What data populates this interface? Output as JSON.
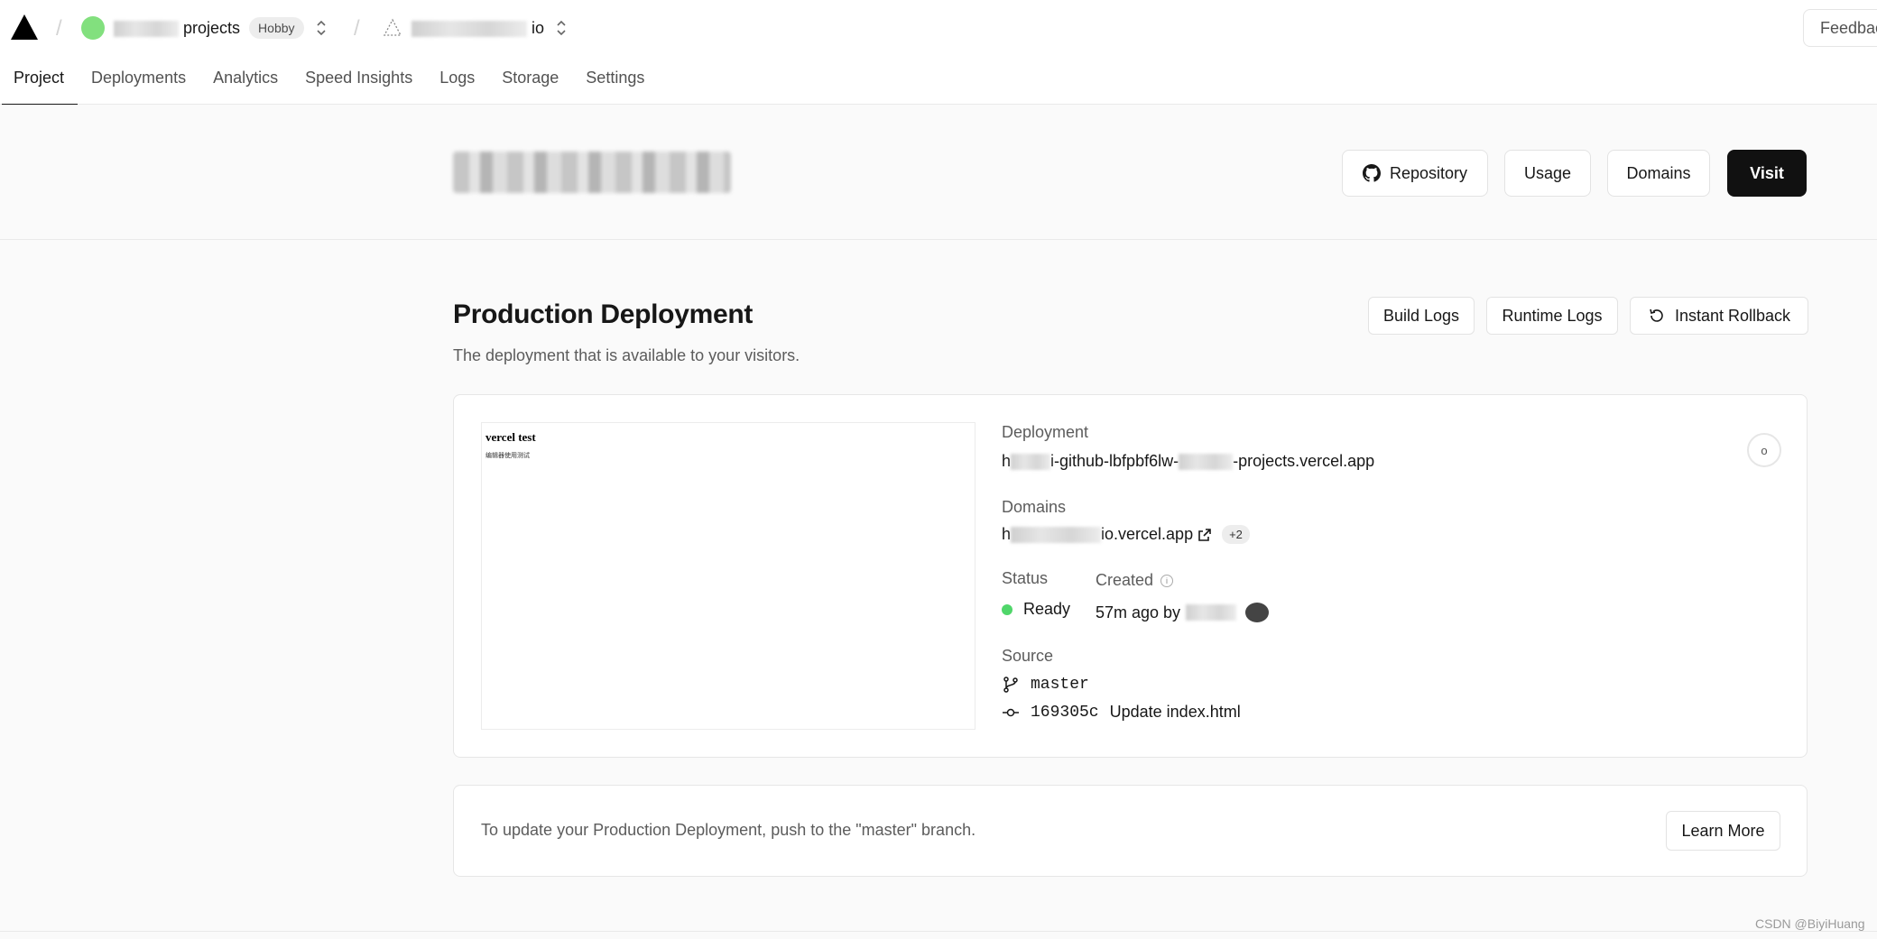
{
  "header": {
    "team_name": "projects",
    "plan_badge": "Hobby",
    "project_name": "io",
    "feedback_label": "Feedbac"
  },
  "tabs": [
    "Project",
    "Deployments",
    "Analytics",
    "Speed Insights",
    "Logs",
    "Storage",
    "Settings"
  ],
  "project_header": {
    "repository_label": "Repository",
    "usage_label": "Usage",
    "domains_label": "Domains",
    "visit_label": "Visit"
  },
  "production": {
    "title": "Production Deployment",
    "subtitle": "The deployment that is available to your visitors.",
    "build_logs_label": "Build Logs",
    "runtime_logs_label": "Runtime Logs",
    "rollback_label": "Instant Rollback"
  },
  "deployment": {
    "preview_title": "vercel test",
    "preview_text": "编辑器使用测试",
    "deployment_label": "Deployment",
    "deployment_url": "i-github-lbfpbf6lw-",
    "deployment_url_tail": "-projects.vercel.app",
    "domains_label": "Domains",
    "domain_url": "io.vercel.app",
    "domains_extra": "+2",
    "status_label": "Status",
    "status_value": "Ready",
    "created_label": "Created",
    "created_value": "57m ago by",
    "source_label": "Source",
    "branch": "master",
    "commit_hash": "169305c",
    "commit_message": "Update index.html",
    "circle_label": "o"
  },
  "update_notice": {
    "text": "To update your Production Deployment, push to the \"master\" branch.",
    "learn_more_label": "Learn More"
  },
  "watermark": "CSDN @BiyiHuang",
  "colors": {
    "status_ready": "#50d66a",
    "team_avatar": "#82e07e",
    "visit_button": "#111111"
  }
}
